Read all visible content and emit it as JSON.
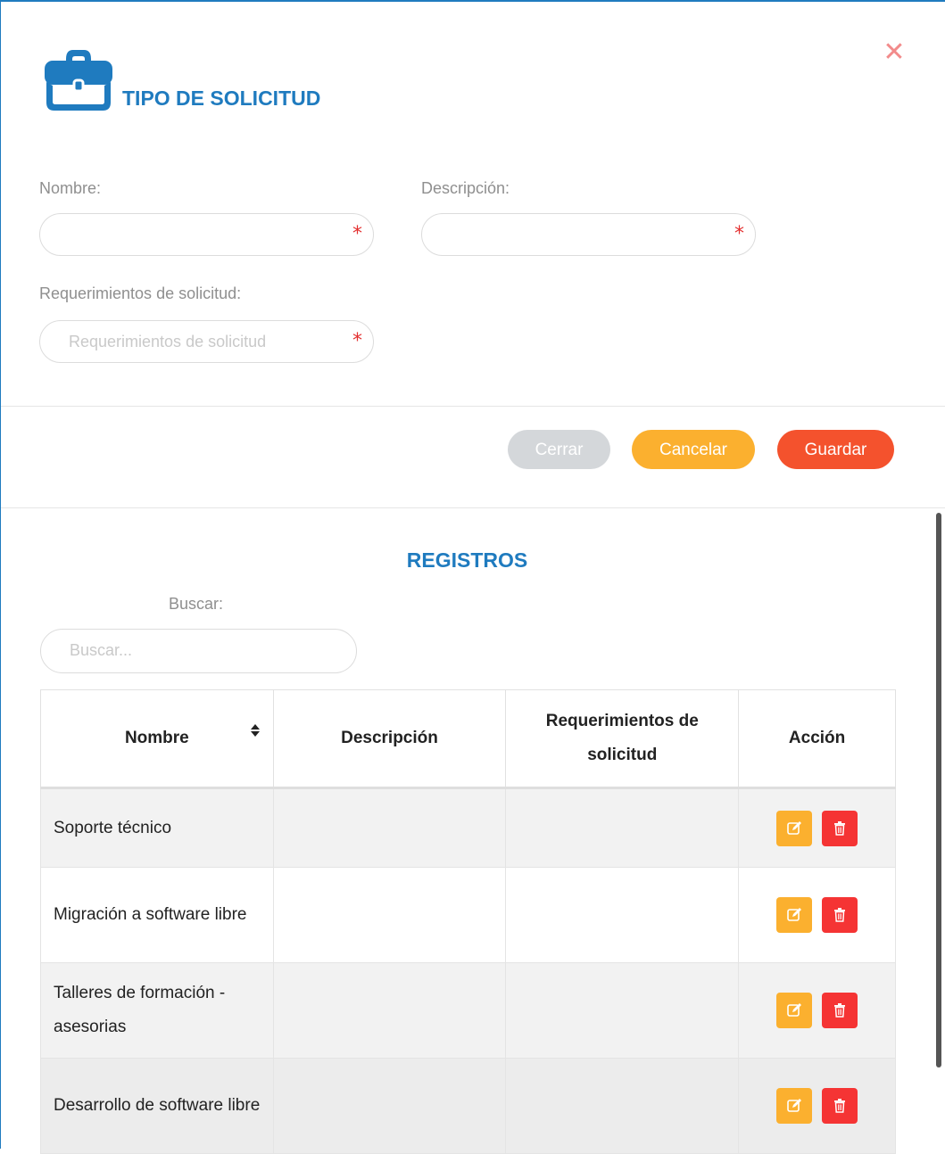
{
  "modal": {
    "title": "TIPO DE SOLICITUD",
    "close_symbol": "✕"
  },
  "form": {
    "nombre": {
      "label": "Nombre:",
      "value": "",
      "placeholder": "",
      "required_mark": "*"
    },
    "descripcion": {
      "label": "Descripción:",
      "value": "",
      "placeholder": "",
      "required_mark": "*"
    },
    "requerimientos": {
      "label": "Requerimientos de solicitud:",
      "value": "",
      "placeholder": "Requerimientos de solicitud",
      "required_mark": "*"
    }
  },
  "buttons": {
    "cerrar": "Cerrar",
    "cancelar": "Cancelar",
    "guardar": "Guardar"
  },
  "registros": {
    "title": "REGISTROS",
    "search_label": "Buscar:",
    "search_placeholder": "Buscar...",
    "columns": [
      "Nombre",
      "Descripción",
      "Requerimientos de solicitud",
      "Acción"
    ],
    "rows": [
      {
        "nombre": "Soporte técnico",
        "descripcion": "",
        "requerimientos": ""
      },
      {
        "nombre": "Migración a software libre",
        "descripcion": "",
        "requerimientos": ""
      },
      {
        "nombre": "Talleres de formación - asesorias",
        "descripcion": "",
        "requerimientos": ""
      },
      {
        "nombre": "Desarrollo de software libre",
        "descripcion": "",
        "requerimientos": ""
      }
    ]
  },
  "colors": {
    "accent": "#1f7bbf",
    "cerrar": "#d4d7da",
    "cancelar": "#fbb02f",
    "guardar": "#f4522d",
    "edit": "#fbb02f",
    "delete": "#f53434"
  },
  "icons": {
    "header": "briefcase-icon",
    "sort": "sort-icon",
    "edit": "edit-icon",
    "delete": "trash-icon",
    "close": "close-icon"
  }
}
